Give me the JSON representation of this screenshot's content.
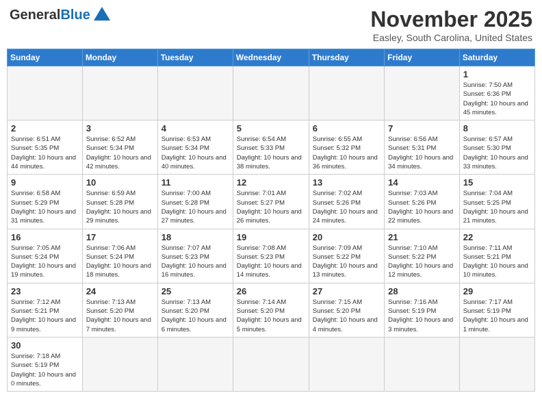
{
  "header": {
    "logo_general": "General",
    "logo_blue": "Blue",
    "month_title": "November 2025",
    "location": "Easley, South Carolina, United States"
  },
  "weekdays": [
    "Sunday",
    "Monday",
    "Tuesday",
    "Wednesday",
    "Thursday",
    "Friday",
    "Saturday"
  ],
  "weeks": [
    [
      {
        "day": "",
        "info": ""
      },
      {
        "day": "",
        "info": ""
      },
      {
        "day": "",
        "info": ""
      },
      {
        "day": "",
        "info": ""
      },
      {
        "day": "",
        "info": ""
      },
      {
        "day": "",
        "info": ""
      },
      {
        "day": "1",
        "info": "Sunrise: 7:50 AM\nSunset: 6:36 PM\nDaylight: 10 hours and 45 minutes."
      }
    ],
    [
      {
        "day": "2",
        "info": "Sunrise: 6:51 AM\nSunset: 5:35 PM\nDaylight: 10 hours and 44 minutes."
      },
      {
        "day": "3",
        "info": "Sunrise: 6:52 AM\nSunset: 5:34 PM\nDaylight: 10 hours and 42 minutes."
      },
      {
        "day": "4",
        "info": "Sunrise: 6:53 AM\nSunset: 5:34 PM\nDaylight: 10 hours and 40 minutes."
      },
      {
        "day": "5",
        "info": "Sunrise: 6:54 AM\nSunset: 5:33 PM\nDaylight: 10 hours and 38 minutes."
      },
      {
        "day": "6",
        "info": "Sunrise: 6:55 AM\nSunset: 5:32 PM\nDaylight: 10 hours and 36 minutes."
      },
      {
        "day": "7",
        "info": "Sunrise: 6:56 AM\nSunset: 5:31 PM\nDaylight: 10 hours and 34 minutes."
      },
      {
        "day": "8",
        "info": "Sunrise: 6:57 AM\nSunset: 5:30 PM\nDaylight: 10 hours and 33 minutes."
      }
    ],
    [
      {
        "day": "9",
        "info": "Sunrise: 6:58 AM\nSunset: 5:29 PM\nDaylight: 10 hours and 31 minutes."
      },
      {
        "day": "10",
        "info": "Sunrise: 6:59 AM\nSunset: 5:28 PM\nDaylight: 10 hours and 29 minutes."
      },
      {
        "day": "11",
        "info": "Sunrise: 7:00 AM\nSunset: 5:28 PM\nDaylight: 10 hours and 27 minutes."
      },
      {
        "day": "12",
        "info": "Sunrise: 7:01 AM\nSunset: 5:27 PM\nDaylight: 10 hours and 26 minutes."
      },
      {
        "day": "13",
        "info": "Sunrise: 7:02 AM\nSunset: 5:26 PM\nDaylight: 10 hours and 24 minutes."
      },
      {
        "day": "14",
        "info": "Sunrise: 7:03 AM\nSunset: 5:26 PM\nDaylight: 10 hours and 22 minutes."
      },
      {
        "day": "15",
        "info": "Sunrise: 7:04 AM\nSunset: 5:25 PM\nDaylight: 10 hours and 21 minutes."
      }
    ],
    [
      {
        "day": "16",
        "info": "Sunrise: 7:05 AM\nSunset: 5:24 PM\nDaylight: 10 hours and 19 minutes."
      },
      {
        "day": "17",
        "info": "Sunrise: 7:06 AM\nSunset: 5:24 PM\nDaylight: 10 hours and 18 minutes."
      },
      {
        "day": "18",
        "info": "Sunrise: 7:07 AM\nSunset: 5:23 PM\nDaylight: 10 hours and 16 minutes."
      },
      {
        "day": "19",
        "info": "Sunrise: 7:08 AM\nSunset: 5:23 PM\nDaylight: 10 hours and 14 minutes."
      },
      {
        "day": "20",
        "info": "Sunrise: 7:09 AM\nSunset: 5:22 PM\nDaylight: 10 hours and 13 minutes."
      },
      {
        "day": "21",
        "info": "Sunrise: 7:10 AM\nSunset: 5:22 PM\nDaylight: 10 hours and 12 minutes."
      },
      {
        "day": "22",
        "info": "Sunrise: 7:11 AM\nSunset: 5:21 PM\nDaylight: 10 hours and 10 minutes."
      }
    ],
    [
      {
        "day": "23",
        "info": "Sunrise: 7:12 AM\nSunset: 5:21 PM\nDaylight: 10 hours and 9 minutes."
      },
      {
        "day": "24",
        "info": "Sunrise: 7:13 AM\nSunset: 5:20 PM\nDaylight: 10 hours and 7 minutes."
      },
      {
        "day": "25",
        "info": "Sunrise: 7:13 AM\nSunset: 5:20 PM\nDaylight: 10 hours and 6 minutes."
      },
      {
        "day": "26",
        "info": "Sunrise: 7:14 AM\nSunset: 5:20 PM\nDaylight: 10 hours and 5 minutes."
      },
      {
        "day": "27",
        "info": "Sunrise: 7:15 AM\nSunset: 5:20 PM\nDaylight: 10 hours and 4 minutes."
      },
      {
        "day": "28",
        "info": "Sunrise: 7:16 AM\nSunset: 5:19 PM\nDaylight: 10 hours and 3 minutes."
      },
      {
        "day": "29",
        "info": "Sunrise: 7:17 AM\nSunset: 5:19 PM\nDaylight: 10 hours and 1 minute."
      }
    ],
    [
      {
        "day": "30",
        "info": "Sunrise: 7:18 AM\nSunset: 5:19 PM\nDaylight: 10 hours and 0 minutes."
      },
      {
        "day": "",
        "info": ""
      },
      {
        "day": "",
        "info": ""
      },
      {
        "day": "",
        "info": ""
      },
      {
        "day": "",
        "info": ""
      },
      {
        "day": "",
        "info": ""
      },
      {
        "day": "",
        "info": ""
      }
    ]
  ]
}
